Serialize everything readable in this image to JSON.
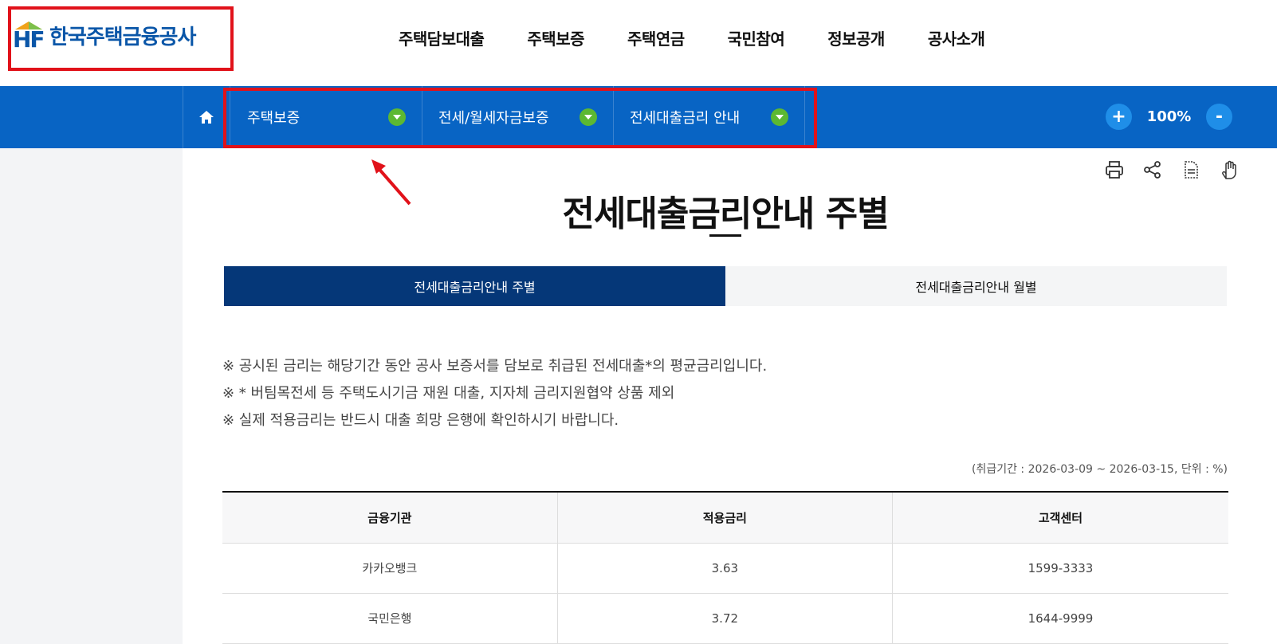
{
  "header": {
    "logo_mark": "HF",
    "logo_text": "한국주택금융공사",
    "nav": [
      "주택담보대출",
      "주택보증",
      "주택연금",
      "국민참여",
      "정보공개",
      "공사소개"
    ]
  },
  "breadcrumb": {
    "home_icon": "home-icon",
    "items": [
      "주택보증",
      "전세/월세자금보증",
      "전세대출금리 안내"
    ]
  },
  "zoom": {
    "plus": "+",
    "value": "100%",
    "minus": "-"
  },
  "tools": [
    "print-icon",
    "share-icon",
    "document-icon",
    "hand-icon"
  ],
  "page_title": "전세대출금리안내 주별",
  "tabs": [
    {
      "label": "전세대출금리안내 주별",
      "active": true
    },
    {
      "label": "전세대출금리안내 월별",
      "active": false
    }
  ],
  "notes": [
    "※ 공시된 금리는 해당기간 동안 공사 보증서를 담보로 취급된 전세대출*의 평균금리입니다.",
    "※ * 버팀목전세 등 주택도시기금 재원 대출, 지자체 금리지원협약 상품 제외",
    "※ 실제 적용금리는 반드시 대출 희망 은행에 확인하시기 바랍니다."
  ],
  "period": "(취급기간 : 2026-03-09 ~ 2026-03-15, 단위 : %)",
  "table": {
    "headers": [
      "금융기관",
      "적용금리",
      "고객센터"
    ],
    "rows": [
      [
        "카카오뱅크",
        "3.63",
        "1599-3333"
      ],
      [
        "국민은행",
        "3.72",
        "1644-9999"
      ]
    ]
  },
  "colors": {
    "brand_blue": "#0864c4",
    "active_tab": "#053778",
    "highlight_red": "#e1121a",
    "dropdown_green": "#5cb832"
  }
}
